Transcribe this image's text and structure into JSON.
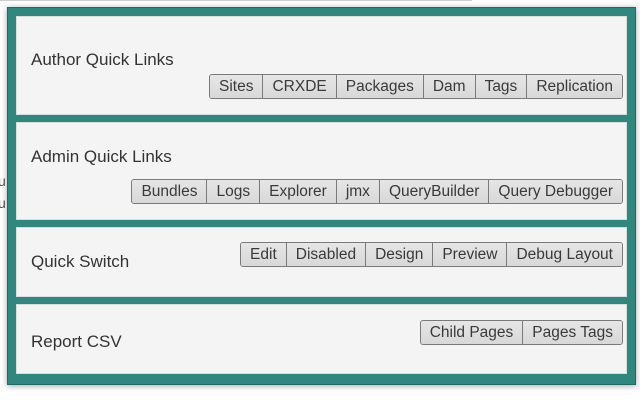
{
  "background": {
    "glyphs": [
      "u",
      "u"
    ]
  },
  "colors": {
    "frame": "#2e8880",
    "panel": "#f4f4f4",
    "button": "#dedede"
  },
  "panels": {
    "author": {
      "title": "Author Quick Links",
      "buttons": [
        "Sites",
        "CRXDE",
        "Packages",
        "Dam",
        "Tags",
        "Replication"
      ]
    },
    "admin": {
      "title": "Admin Quick Links",
      "buttons": [
        "Bundles",
        "Logs",
        "Explorer",
        "jmx",
        "QueryBuilder",
        "Query Debugger"
      ]
    },
    "switch": {
      "title": "Quick Switch",
      "buttons": [
        "Edit",
        "Disabled",
        "Design",
        "Preview",
        "Debug Layout"
      ]
    },
    "report": {
      "title": "Report CSV",
      "buttons": [
        "Child Pages",
        "Pages Tags"
      ]
    }
  }
}
